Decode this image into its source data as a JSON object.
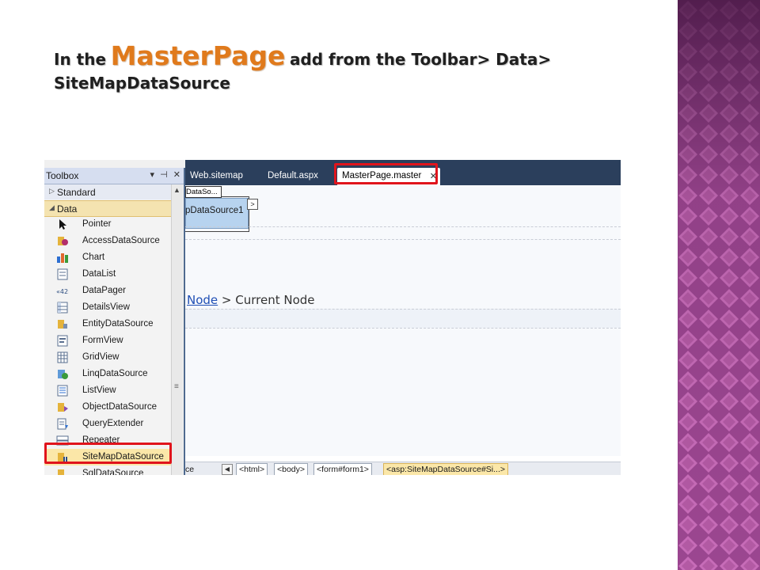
{
  "slide": {
    "title_prefix": "In the",
    "title_emphasis": "MasterPage",
    "title_suffix": "add from the Toolbar> Data>",
    "title_line2": "SiteMapDataSource",
    "accent_color": "#e07a1c",
    "deco_color": "#a14a91"
  },
  "toolbox": {
    "title": "Toolbox",
    "header_icons": [
      "dropdown-icon",
      "pin-icon",
      "close-icon"
    ],
    "header_glyphs": {
      "dropdown": "▾",
      "pin": "⊣",
      "close": "✕"
    },
    "categories": [
      {
        "label": "Standard",
        "expanded": false,
        "glyph": "▷"
      },
      {
        "label": "Data",
        "expanded": true,
        "glyph": "◢"
      }
    ],
    "tools": [
      {
        "label": "Pointer",
        "icon": "pointer-icon"
      },
      {
        "label": "AccessDataSource",
        "icon": "access-datasource-icon"
      },
      {
        "label": "Chart",
        "icon": "chart-icon"
      },
      {
        "label": "DataList",
        "icon": "datalist-icon"
      },
      {
        "label": "DataPager",
        "icon": "datapager-icon"
      },
      {
        "label": "DetailsView",
        "icon": "detailsview-icon"
      },
      {
        "label": "EntityDataSource",
        "icon": "entity-datasource-icon"
      },
      {
        "label": "FormView",
        "icon": "formview-icon"
      },
      {
        "label": "GridView",
        "icon": "gridview-icon"
      },
      {
        "label": "LinqDataSource",
        "icon": "linq-datasource-icon"
      },
      {
        "label": "ListView",
        "icon": "listview-icon"
      },
      {
        "label": "ObjectDataSource",
        "icon": "object-datasource-icon"
      },
      {
        "label": "QueryExtender",
        "icon": "queryextender-icon"
      },
      {
        "label": "Repeater",
        "icon": "repeater-icon"
      },
      {
        "label": "SiteMapDataSource",
        "icon": "sitemap-datasource-icon",
        "selected": true
      },
      {
        "label": "SqlDataSource",
        "icon": "sql-datasource-icon"
      }
    ],
    "scroll_up_glyph": "▲",
    "scroll_grip_glyph": "≡"
  },
  "editor": {
    "tabs": [
      {
        "label": "Web.sitemap",
        "active": false
      },
      {
        "label": "Default.aspx",
        "active": false
      },
      {
        "label": "MasterPage.master",
        "active": true
      }
    ],
    "tab_close_glyph": "✕",
    "control_tag": "DataSo...",
    "control_label": "pDataSource1",
    "smart_tag_glyph": ">",
    "breadcrumb_link": "Node",
    "breadcrumb_rest": " > Current Node"
  },
  "statusbar": {
    "source_label": "ce",
    "nav_glyph": "◀",
    "crumbs": [
      "<html>",
      "<body>",
      "<form#form1>",
      "<asp:SiteMapDataSource#Si...>"
    ]
  },
  "highlight_color": "#e0141c"
}
